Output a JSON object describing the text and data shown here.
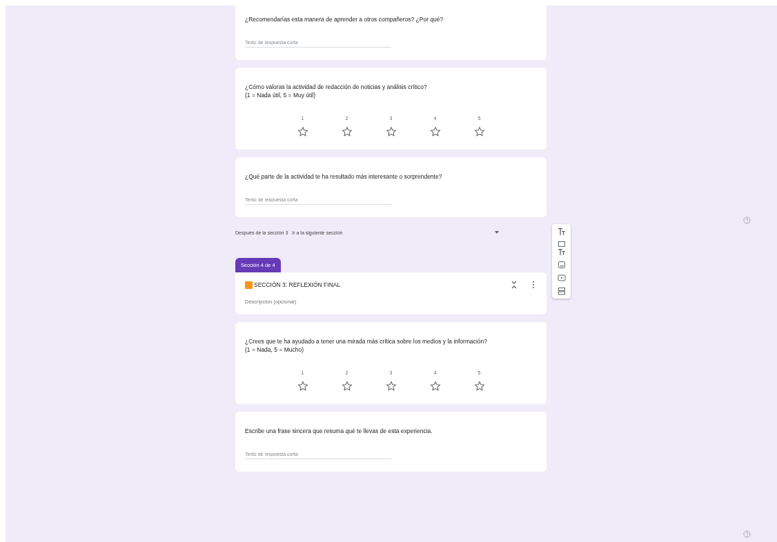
{
  "items": [
    {
      "kind": "short_answer",
      "question": "¿Recomendarías esta manera de aprender a otros compañeros? ¿Por qué?",
      "placeholder": "Texto de respuesta corta",
      "cut_top": true
    },
    {
      "kind": "rating",
      "question": "¿Cómo valoras la actividad de redacción de noticias y análisis crítico?",
      "note": "(1 = Nada útil, 5 = Muy útil)",
      "labels": [
        "1",
        "2",
        "3",
        "4",
        "5"
      ],
      "stars": 0
    },
    {
      "kind": "short_answer",
      "question": "¿Qué parte de la actividad te ha resultado más interesante o sorprendente?",
      "placeholder": "Texto de respuesta corta"
    },
    {
      "kind": "section_nav",
      "label": "Después de la sección 3",
      "value": "Ir a la siguiente sección"
    },
    {
      "kind": "section_header",
      "tab": "Sección 4 de 4",
      "title": "SECCIÓN 3: REFLEXIÓN FINAL",
      "description_placeholder": "Descripción (opcional)"
    },
    {
      "kind": "rating",
      "question": "¿Crees que te ha ayudado a tener una mirada más crítica sobre los medios y la información?",
      "note": "(1 = Nada, 5 = Mucho)",
      "labels": [
        "1",
        "2",
        "3",
        "4",
        "5"
      ],
      "stars": 0
    },
    {
      "kind": "short_answer",
      "question": "Escribe una frase sincera que resuma qué te llevas de esta experiencia.",
      "placeholder": "Texto de respuesta corta"
    }
  ]
}
